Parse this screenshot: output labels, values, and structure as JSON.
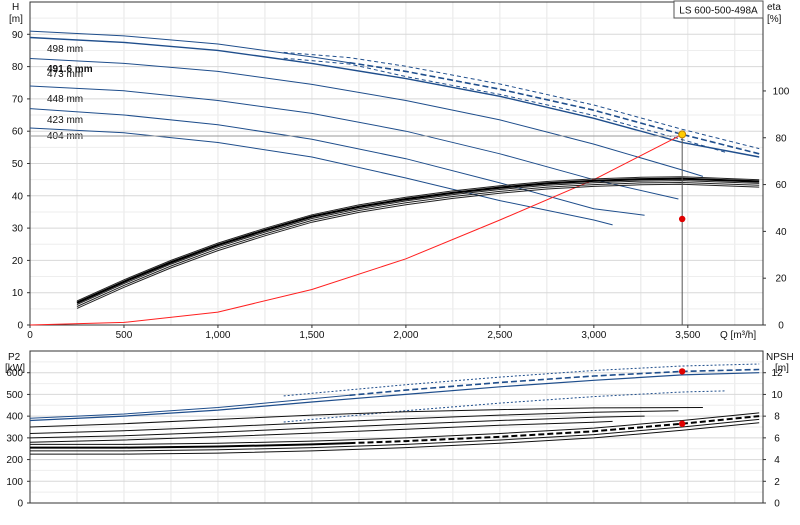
{
  "model_label": "LS 600-500-498A",
  "chart_data": [
    {
      "type": "line",
      "panel": "head",
      "y_left_label": [
        "H",
        "[m]"
      ],
      "y_right_label": [
        "eta",
        "[%]"
      ],
      "x_label": "Q [m³/h]",
      "xlim": [
        0,
        3900
      ],
      "ylim": [
        0,
        100
      ],
      "y_right_lim": [
        0,
        138
      ],
      "grid": true,
      "x_ticks": [
        0,
        500,
        1000,
        1500,
        2000,
        2500,
        3000,
        3500
      ],
      "x_tick_labels": [
        "0",
        "500",
        "1,000",
        "1,500",
        "2,000",
        "2,500",
        "3,000",
        "3,500"
      ],
      "y_ticks": [
        0,
        10,
        20,
        30,
        40,
        50,
        60,
        70,
        80,
        90
      ],
      "y_right_ticks": [
        0,
        20,
        40,
        60,
        80,
        100
      ],
      "impeller_curves": [
        {
          "name": "498 mm",
          "points": [
            [
              0,
              91
            ],
            [
              500,
              89.5
            ],
            [
              1000,
              87
            ],
            [
              1500,
              83
            ],
            [
              2000,
              78.5
            ],
            [
              2500,
              73
            ],
            [
              3000,
              66.5
            ],
            [
              3470,
              59
            ],
            [
              3880,
              53
            ]
          ],
          "dashed_from": 1700,
          "dotted_between": [
            1350,
            1700
          ],
          "upper_dotted_offset": 1.6,
          "lower_dotted_offset": -1.6,
          "upper_points": [
            [
              1350,
              84.4
            ],
            [
              1700,
              82.8
            ],
            [
              2000,
              80.1
            ],
            [
              2500,
              74.6
            ],
            [
              3000,
              68.1
            ],
            [
              3470,
              60.6
            ],
            [
              3880,
              54.6
            ]
          ],
          "lower_points": [
            [
              1350,
              82.6
            ],
            [
              1700,
              80.8
            ],
            [
              2000,
              76.9
            ],
            [
              2500,
              71.4
            ],
            [
              3000,
              64.9
            ],
            [
              3470,
              57.4
            ],
            [
              3700,
              53.5
            ]
          ]
        },
        {
          "name": "491.6 mm",
          "points": [
            [
              0,
              89
            ],
            [
              500,
              87.5
            ],
            [
              1000,
              85
            ],
            [
              1500,
              81
            ],
            [
              2000,
              76.3
            ],
            [
              2500,
              70.8
            ],
            [
              3000,
              64
            ],
            [
              3470,
              56.5
            ],
            [
              3880,
              52
            ]
          ]
        },
        {
          "name": "473 mm",
          "points": [
            [
              0,
              82.5
            ],
            [
              500,
              81
            ],
            [
              1000,
              78.5
            ],
            [
              1500,
              74.5
            ],
            [
              2000,
              69.5
            ],
            [
              2500,
              63.5
            ],
            [
              3000,
              56
            ],
            [
              3470,
              48
            ],
            [
              3580,
              46
            ]
          ]
        },
        {
          "name": "448 mm",
          "points": [
            [
              0,
              74
            ],
            [
              500,
              72.5
            ],
            [
              1000,
              69.5
            ],
            [
              1500,
              65.5
            ],
            [
              2000,
              60
            ],
            [
              2500,
              53
            ],
            [
              3000,
              45
            ],
            [
              3450,
              39
            ]
          ]
        },
        {
          "name": "423 mm",
          "points": [
            [
              0,
              67
            ],
            [
              500,
              65
            ],
            [
              1000,
              62
            ],
            [
              1500,
              57.5
            ],
            [
              2000,
              51.5
            ],
            [
              2500,
              44
            ],
            [
              3000,
              36
            ],
            [
              3270,
              34
            ]
          ]
        },
        {
          "name": "404 mm",
          "points": [
            [
              0,
              61
            ],
            [
              500,
              59.5
            ],
            [
              1000,
              56.5
            ],
            [
              1500,
              52
            ],
            [
              2000,
              45.5
            ],
            [
              2500,
              38.5
            ],
            [
              3000,
              32.5
            ],
            [
              3100,
              31
            ]
          ]
        }
      ],
      "system_curve": {
        "points": [
          [
            0,
            0
          ],
          [
            500,
            0.8
          ],
          [
            1000,
            4
          ],
          [
            1500,
            11
          ],
          [
            2000,
            20.5
          ],
          [
            2500,
            32.5
          ],
          [
            3000,
            45
          ],
          [
            3470,
            59
          ]
        ]
      },
      "efficiency_curve": {
        "points": [
          [
            250,
            9.5
          ],
          [
            500,
            18.5
          ],
          [
            750,
            26.8
          ],
          [
            1000,
            34.2
          ],
          [
            1250,
            40.5
          ],
          [
            1500,
            46.3
          ],
          [
            1750,
            50.5
          ],
          [
            2000,
            53.8
          ],
          [
            2250,
            56.5
          ],
          [
            2500,
            58.7
          ],
          [
            2750,
            60.5
          ],
          [
            3000,
            61.6
          ],
          [
            3250,
            62.3
          ],
          [
            3470,
            62.5
          ],
          [
            3880,
            61.3
          ]
        ]
      },
      "efficiency_variants_offset": [
        -0.8,
        -1.6,
        0.8,
        -2.4
      ],
      "duty_point": {
        "q": 3470,
        "h": 59
      },
      "efficiency_marker": {
        "q": 3470,
        "eta_h": 45.3
      },
      "duty_line_h": 58.5,
      "labels": [
        "498 mm",
        "491.6 mm",
        "473 mm",
        "448 mm",
        "423 mm",
        "404 mm"
      ]
    },
    {
      "type": "line",
      "panel": "power_npsh",
      "y_left_label": [
        "P2",
        "[kW]"
      ],
      "y_right_label": [
        "NPSH",
        "[m]"
      ],
      "xlim": [
        0,
        3900
      ],
      "ylim": [
        0,
        700
      ],
      "y_right_lim": [
        0,
        14
      ],
      "grid": true,
      "y_ticks": [
        0,
        100,
        200,
        300,
        400,
        500,
        600
      ],
      "y_right_ticks": [
        0,
        2,
        4,
        6,
        8,
        10,
        12
      ],
      "power_curves": [
        {
          "name": "498 mm",
          "points": [
            [
              0,
              390
            ],
            [
              500,
              410
            ],
            [
              1000,
              440
            ],
            [
              1500,
              480
            ],
            [
              2000,
              520
            ],
            [
              2500,
              555
            ],
            [
              3000,
              585
            ],
            [
              3470,
              606
            ],
            [
              3880,
              615
            ]
          ],
          "dashed_from": 1700
        },
        {
          "name": "491.6 mm",
          "points": [
            [
              0,
              380
            ],
            [
              500,
              400
            ],
            [
              1000,
              428
            ],
            [
              1500,
              465
            ],
            [
              2000,
              500
            ],
            [
              2500,
              535
            ],
            [
              3000,
              565
            ],
            [
              3470,
              590
            ],
            [
              3880,
              600
            ]
          ]
        },
        {
          "name": "473 mm",
          "points": [
            [
              0,
              350
            ],
            [
              500,
              365
            ],
            [
              1000,
              385
            ],
            [
              1500,
              405
            ],
            [
              2000,
              420
            ],
            [
              2500,
              430
            ],
            [
              3000,
              438
            ],
            [
              3580,
              440
            ]
          ]
        },
        {
          "name": "448 mm",
          "points": [
            [
              0,
              320
            ],
            [
              500,
              333
            ],
            [
              1000,
              350
            ],
            [
              1500,
              370
            ],
            [
              2000,
              388
            ],
            [
              2500,
              405
            ],
            [
              3000,
              418
            ],
            [
              3450,
              425
            ]
          ]
        },
        {
          "name": "423 mm",
          "points": [
            [
              0,
              300
            ],
            [
              500,
              310
            ],
            [
              1000,
              326
            ],
            [
              1500,
              345
            ],
            [
              2000,
              363
            ],
            [
              2500,
              380
            ],
            [
              3000,
              395
            ],
            [
              3270,
              400
            ]
          ]
        },
        {
          "name": "404 mm",
          "points": [
            [
              0,
              280
            ],
            [
              500,
              290
            ],
            [
              1000,
              305
            ],
            [
              1500,
              322
            ],
            [
              2000,
              340
            ],
            [
              2500,
              358
            ],
            [
              3000,
              372
            ],
            [
              3100,
              376
            ]
          ]
        }
      ],
      "npsh_curve": {
        "points": [
          [
            0,
            5.1
          ],
          [
            500,
            5.1
          ],
          [
            1000,
            5.2
          ],
          [
            1500,
            5.4
          ],
          [
            2000,
            5.7
          ],
          [
            2500,
            6.1
          ],
          [
            3000,
            6.6
          ],
          [
            3470,
            7.3
          ],
          [
            3880,
            8.0
          ]
        ],
        "dashed_from": 1700
      },
      "power_marker": {
        "q": 3470,
        "p": 606
      },
      "npsh_marker": {
        "q": 3470,
        "npsh": 7.3
      }
    }
  ]
}
